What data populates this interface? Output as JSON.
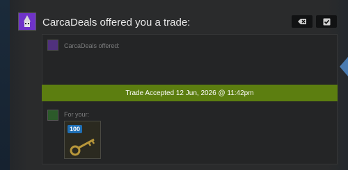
{
  "notification": {
    "sender_name": "CarcaDeals",
    "header_text": "CarcaDeals offered you a trade:",
    "offered_label": "CarcaDeals offered:",
    "for_your_label": "For your:",
    "status_banner": "Trade Accepted 12 Jun, 2026 @ 11:42pm"
  },
  "buttons": {
    "decline_icon": "decline-icon",
    "accept_icon": "checkmark-icon"
  },
  "items": [
    {
      "badge": "100",
      "icon": "key-icon"
    }
  ],
  "colors": {
    "accepted_banner": "#5c7e10",
    "sender_avatar": "#6f33c9",
    "item_badge": "#1f6fb4"
  }
}
